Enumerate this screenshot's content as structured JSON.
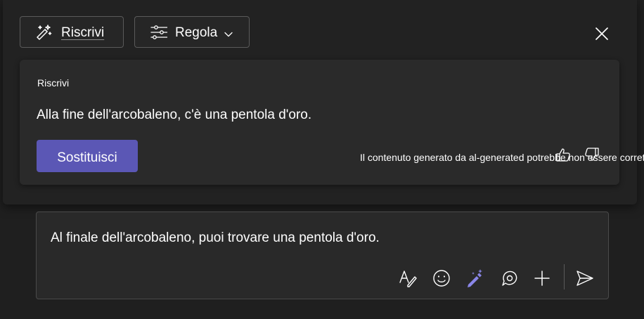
{
  "toolbar": {
    "rewrite_label": "Riscrivi",
    "adjust_label": "Regola"
  },
  "card": {
    "title": "Riscrivi",
    "suggestion": "Alla fine dell'arcobaleno, c'è una pentola d'oro.",
    "replace_label": "Sostituisci",
    "disclaimer": "Il contenuto generato da al-generated potrebbe non essere corretto"
  },
  "compose": {
    "text": "Al finale dell'arcobaleno, puoi trovare una pentola d'oro."
  },
  "icons": {
    "rewrite": "magic-pen-icon",
    "adjust": "sliders-icon",
    "chevron": "chevron-down-icon",
    "close": "close-icon",
    "thumbs_up": "thumbs-up-icon",
    "thumbs_down": "thumbs-down-icon",
    "format": "format-text-icon",
    "emoji": "emoji-icon",
    "copilot": "copilot-pen-icon",
    "loop": "loop-icon",
    "add": "plus-icon",
    "send": "send-icon"
  },
  "colors": {
    "accent": "#5b57b5",
    "copilot_icon": "#8a86e8",
    "background": "#1f1f1f"
  }
}
